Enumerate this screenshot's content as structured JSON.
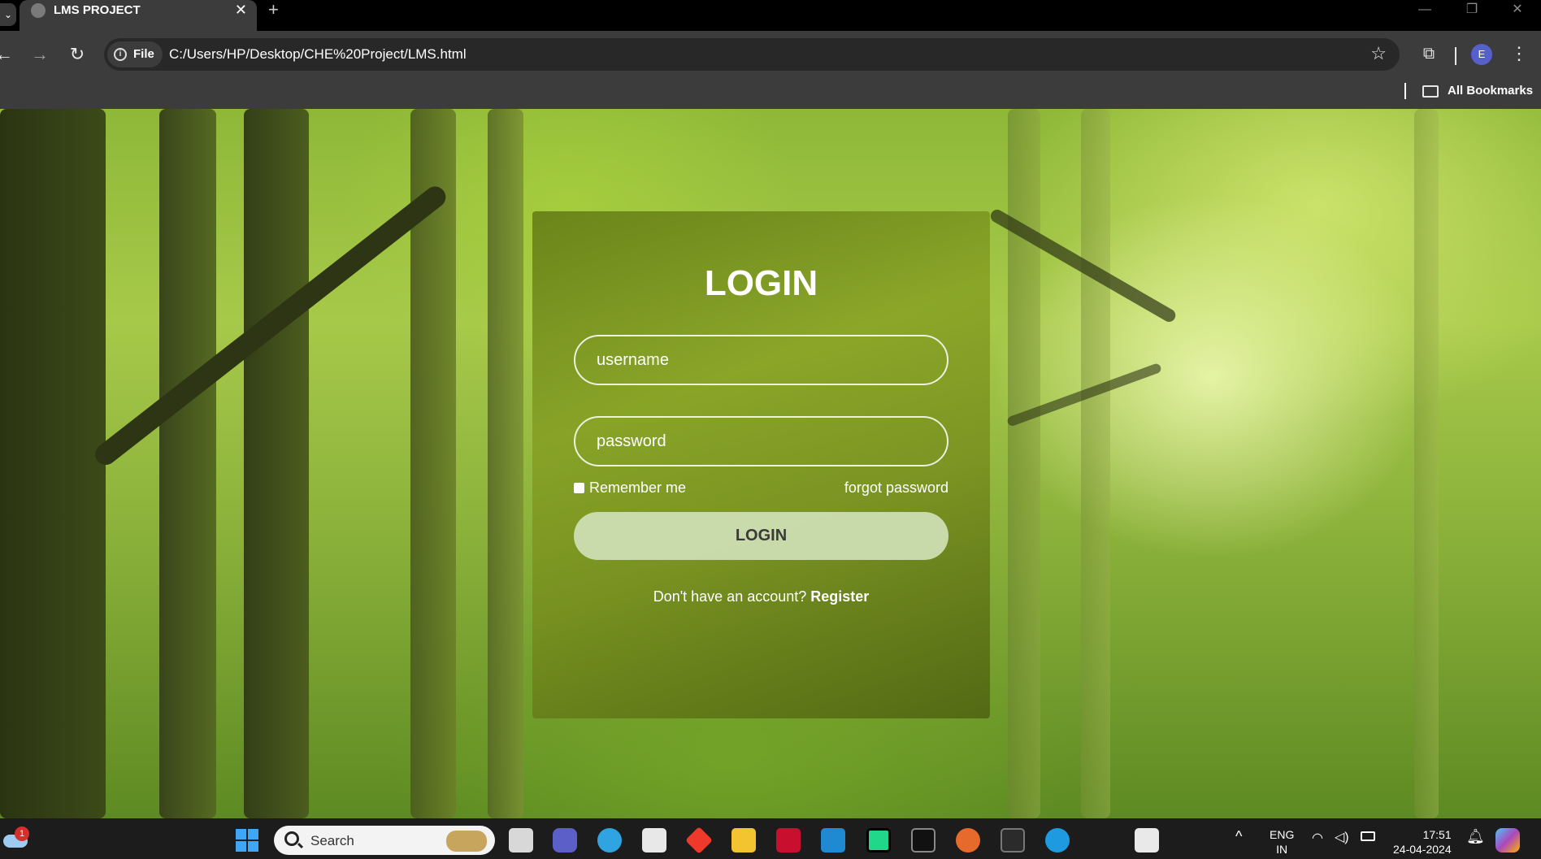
{
  "browser": {
    "tab_title": "LMS PROJECT",
    "tab_close": "✕",
    "new_tab": "+",
    "window_controls": [
      "—",
      "❐",
      "✕"
    ],
    "site_chip_label": "File",
    "url": "C:/Users/HP/Desktop/CHE%20Project/LMS.html",
    "profile_initial": "E",
    "bookmarks_label": "All Bookmarks"
  },
  "login": {
    "title": "LOGIN",
    "username_placeholder": "username",
    "password_placeholder": "password",
    "remember_label": "Remember me",
    "forgot_label": "forgot password",
    "button_label": "LOGIN",
    "register_prompt": "Don't have an account? ",
    "register_link": "Register"
  },
  "taskbar": {
    "weather_badge": "1",
    "search_label": "Search",
    "language": "ENG",
    "region": "IN",
    "time": "17:51",
    "date": "24-04-2024",
    "icons": [
      "task-view-icon",
      "meet-icon",
      "edge-dev-icon",
      "store-icon",
      "anydesk-icon",
      "file-explorer-icon",
      "mcafee-icon",
      "vscode-icon",
      "pycharm-icon",
      "terminal-icon",
      "firefox-icon",
      "powershell-icon",
      "edge-icon",
      "snipping-tool-icon"
    ]
  },
  "colors": {
    "accent": "#a7c94a",
    "card": "#7a9420",
    "button": "#cddeb2"
  }
}
